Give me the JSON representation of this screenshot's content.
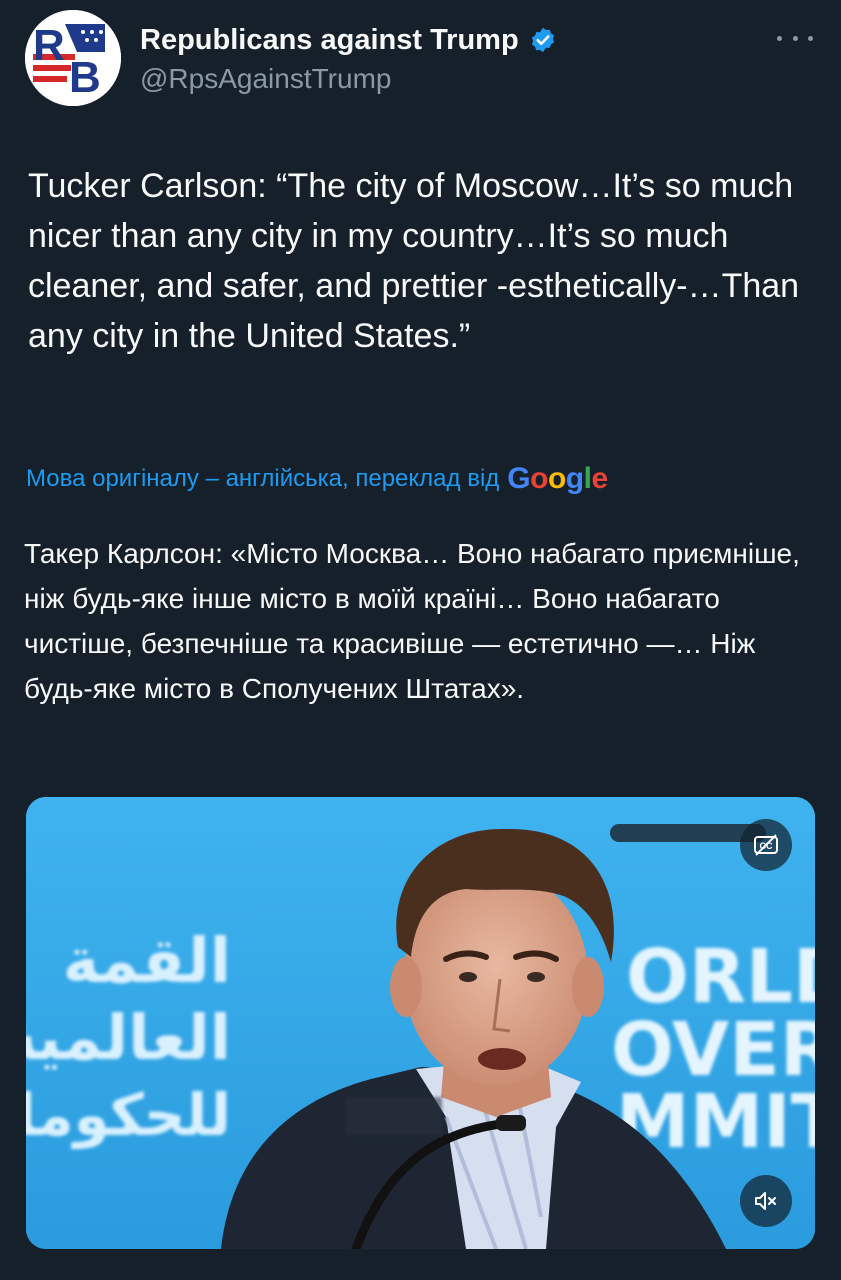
{
  "author": {
    "name": "Republicans against Trump",
    "handle": "@RpsAgainstTrump",
    "avatar_letters": "RB",
    "verified": true
  },
  "tweet": {
    "text": "Tucker Carlson: “The city of Moscow…It’s so much nicer than any city in my country…It’s so much cleaner, and safer, and prettier -esthetically-…Than any city in the United States.”"
  },
  "translation": {
    "note": "Мова оригіналу – англійська, переклад від",
    "provider": "Google",
    "text": "Такер Карлсон: «Місто Москва… Воно набагато приємніше, ніж будь-яке інше місто в моїй країні… Воно набагато чистіше, безпечніше та красивіше — естетично —… Ніж будь-яке місто в Сполучених Штатах»."
  },
  "video": {
    "backdrop_left": [
      "القمة",
      "العالمية",
      "للحكومات"
    ],
    "backdrop_right": [
      "ORLD",
      "OVERN",
      "MMIT"
    ],
    "captions_icon": "closed-captions-off-icon",
    "mute_icon": "speaker-muted-icon"
  },
  "colors": {
    "background": "#15202b",
    "text": "#f7f9f9",
    "secondary_text": "#8b98a5",
    "link": "#1d9bf0",
    "verified": "#1d9bf0",
    "video_backdrop": "#33aaea"
  }
}
